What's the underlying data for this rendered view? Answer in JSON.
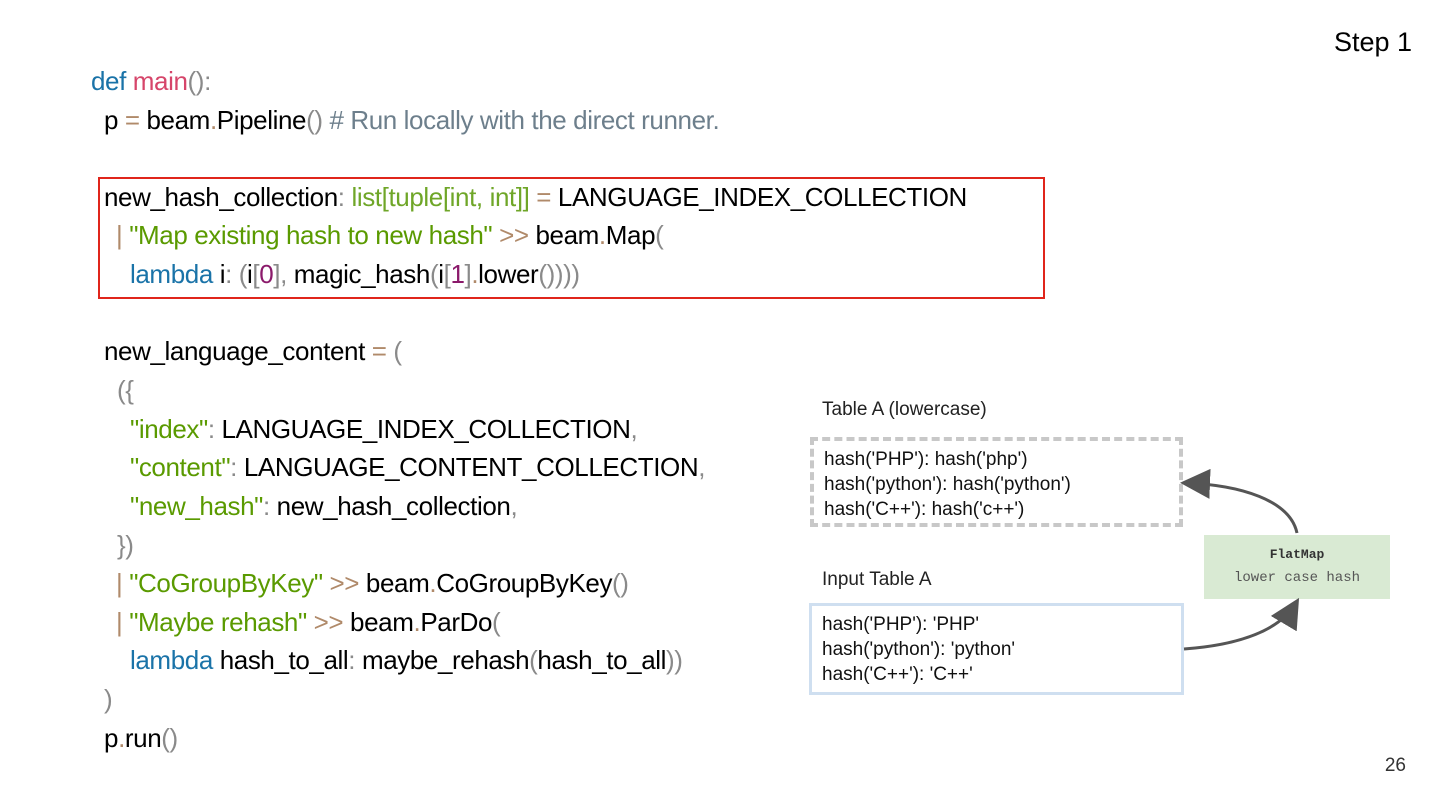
{
  "slide": {
    "step": "Step 1",
    "page_number": "26"
  },
  "code": {
    "l1_def": "def",
    "l1_name": "main",
    "l1_rest": "():",
    "l2_p": "p",
    "l2_eq": " = ",
    "l2_beam": "beam",
    "l2_dot": ".",
    "l2_pipe": "Pipeline",
    "l2_paren": "()",
    "l2_comment": " # Run locally with the direct runner.",
    "l3_var": "new_hash_collection",
    "l3_colon": ": ",
    "l3_type": "list[tuple[int, int]]",
    "l3_eq": " = ",
    "l3_val": "LANGUAGE_INDEX_COLLECTION",
    "l4_bar": "| ",
    "l4_str": "\"Map existing hash to new hash\"",
    "l4_op": " >> ",
    "l4_beam": "beam",
    "l4_dot": ".",
    "l4_map": "Map",
    "l4_paren": "(",
    "l5_lambda": "lambda",
    "l5_i": " i",
    "l5_colon": ": ",
    "l5_p1": "(",
    "l5_i2": "i",
    "l5_b1": "[",
    "l5_zero": "0",
    "l5_b2": "]",
    "l5_comma": ", ",
    "l5_fn": "magic_hash",
    "l5_p2": "(",
    "l5_i3": "i",
    "l5_b3": "[",
    "l5_one": "1",
    "l5_b4": "]",
    "l5_dot": ".",
    "l5_lower": "lower",
    "l5_end": "()))) ",
    "l6_var": "new_language_content",
    "l6_eq": " = ",
    "l6_paren": "(",
    "l7": "({",
    "l8_key": "\"index\"",
    "l8_colon": ": ",
    "l8_val": "LANGUAGE_INDEX_COLLECTION",
    "l8_comma": ",",
    "l9_key": "\"content\"",
    "l9_colon": ": ",
    "l9_val": "LANGUAGE_CONTENT_COLLECTION",
    "l9_comma": ",",
    "l10_key": "\"new_hash\"",
    "l10_colon": ": ",
    "l10_val": "new_hash_collection",
    "l10_comma": ",",
    "l11": "})",
    "l12_bar": "| ",
    "l12_str": "\"CoGroupByKey\"",
    "l12_op": " >> ",
    "l12_beam": "beam",
    "l12_dot": ".",
    "l12_fn": "CoGroupByKey",
    "l12_paren": "()",
    "l13_bar": "| ",
    "l13_str": "\"Maybe rehash\"",
    "l13_op": " >> ",
    "l13_beam": "beam",
    "l13_dot": ".",
    "l13_fn": "ParDo",
    "l13_paren": "(",
    "l14_lambda": "lambda",
    "l14_arg": " hash_to_all",
    "l14_colon": ": ",
    "l14_fn": "maybe_rehash",
    "l14_p1": "(",
    "l14_arg2": "hash_to_all",
    "l14_p2": "))",
    "l15": ")",
    "l16_p": "p",
    "l16_dot": ".",
    "l16_run": "run",
    "l16_paren": "()"
  },
  "diagram": {
    "table_a_lower_label": "Table A (lowercase)",
    "table_a_lower_rows": [
      "hash('PHP'): hash('php')",
      "hash('python'): hash('python')",
      "hash('C++'): hash('c++')"
    ],
    "input_table_label": "Input Table A",
    "input_table_rows": [
      "hash('PHP'): 'PHP'",
      "hash('python'): 'python'",
      "hash('C++'): 'C++'"
    ],
    "flatmap_title": "FlatMap",
    "flatmap_subtitle": "lower case hash"
  },
  "colors": {
    "highlight_border": "#e0251b",
    "flatmap_bg": "#d9ead3",
    "keyword": "#1a73a8",
    "string": "#5a9a00"
  }
}
